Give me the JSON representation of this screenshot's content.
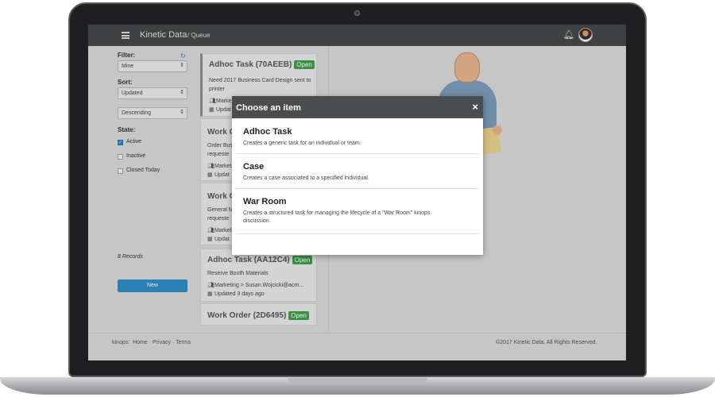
{
  "header": {
    "brand": "Kinetic Data",
    "breadcrumb": "/ Queue"
  },
  "sidebar": {
    "filter_label": "Filter:",
    "filter_value": "Mine",
    "sort_label": "Sort:",
    "sort_value": "Updated",
    "direction_value": "Descending",
    "state_label": "State:",
    "states": [
      {
        "label": "Active",
        "checked": true
      },
      {
        "label": "Inactive",
        "checked": false
      },
      {
        "label": "Closed Today",
        "checked": false
      }
    ],
    "records": "8 Records",
    "new_button": "New"
  },
  "list": [
    {
      "title": "Adhoc Task (70AEEB)",
      "badge": "Open",
      "lines": [
        "Need 2017 Business Card Design sent to",
        "printer"
      ],
      "meta1": "Market",
      "meta2": "Updat"
    },
    {
      "title": "Work O",
      "lines": [
        "Order Bus",
        "requeste"
      ],
      "meta1": "Market",
      "meta2": "Updat"
    },
    {
      "title": "Work O",
      "lines": [
        "General M",
        "requeste"
      ],
      "meta1": "Market",
      "meta2": "Updat"
    },
    {
      "title": "Adhoc Task (AA12C4)",
      "badge": "Open",
      "lines": [
        "Reserve Booth Materials"
      ],
      "meta1": "Marketing > Susan.Wojcicki@acm...",
      "meta2": "Updated 3 days ago"
    },
    {
      "title": "Work Order (2D6495)",
      "badge": "Open"
    }
  ],
  "modal": {
    "title": "Choose an item",
    "close": "×",
    "items": [
      {
        "title": "Adhoc Task",
        "desc": "Creates a generic task for an individual or team."
      },
      {
        "title": "Case",
        "desc": "Creates a case associated to a specified individual."
      },
      {
        "title": "War Room",
        "desc": "Creates a structured task for managing the lifecycle of a \"War Room\" kinops discussion."
      }
    ]
  },
  "footer": {
    "prefix": "kinops:",
    "links": [
      "Home",
      "Privacy",
      "Terms"
    ],
    "separator": "·",
    "copyright": "©2017 Kinetic Data. All Rights Reserved."
  },
  "colors": {
    "accent": "#2f8bc6",
    "badge_green": "#3e9e4a",
    "topbar": "#3f4142"
  },
  "icons": [
    "hamburger-icon",
    "bell-icon",
    "refresh-icon",
    "users-icon",
    "calendar-icon",
    "close-icon"
  ]
}
